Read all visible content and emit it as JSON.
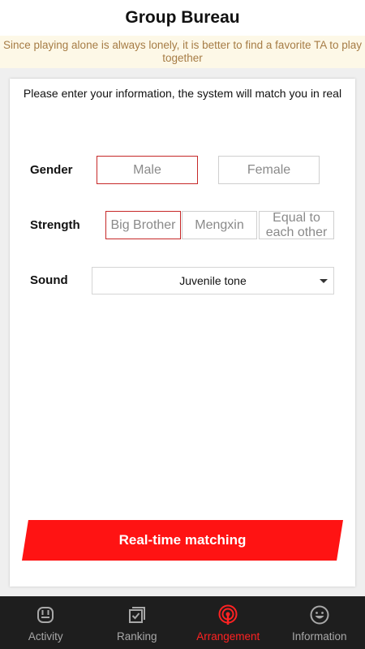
{
  "header": {
    "title": "Group Bureau"
  },
  "notice": {
    "text": "Since playing alone is always lonely, it is better to find a favorite TA to play together"
  },
  "card": {
    "intro": "Please enter your information, the system will match you in real",
    "gender": {
      "label": "Gender",
      "options": [
        "Male",
        "Female"
      ],
      "selected": "Male"
    },
    "strength": {
      "label": "Strength",
      "options": [
        "Big Brother",
        "Mengxin",
        "Equal to each other"
      ],
      "selected": "Big Brother"
    },
    "sound": {
      "label": "Sound",
      "value": "Juvenile tone"
    },
    "button_label": "Real-time matching"
  },
  "tabbar": {
    "items": [
      {
        "label": "Activity",
        "icon": "activity-icon"
      },
      {
        "label": "Ranking",
        "icon": "ranking-icon"
      },
      {
        "label": "Arrangement",
        "icon": "arrangement-icon"
      },
      {
        "label": "Information",
        "icon": "information-icon"
      }
    ],
    "active": "Arrangement"
  },
  "colors": {
    "accent": "#ff1313",
    "selected_border": "#c62828",
    "notice_bg": "#fdf8e7",
    "notice_text": "#a67c45",
    "tabbar_bg": "#1e1e1e"
  }
}
